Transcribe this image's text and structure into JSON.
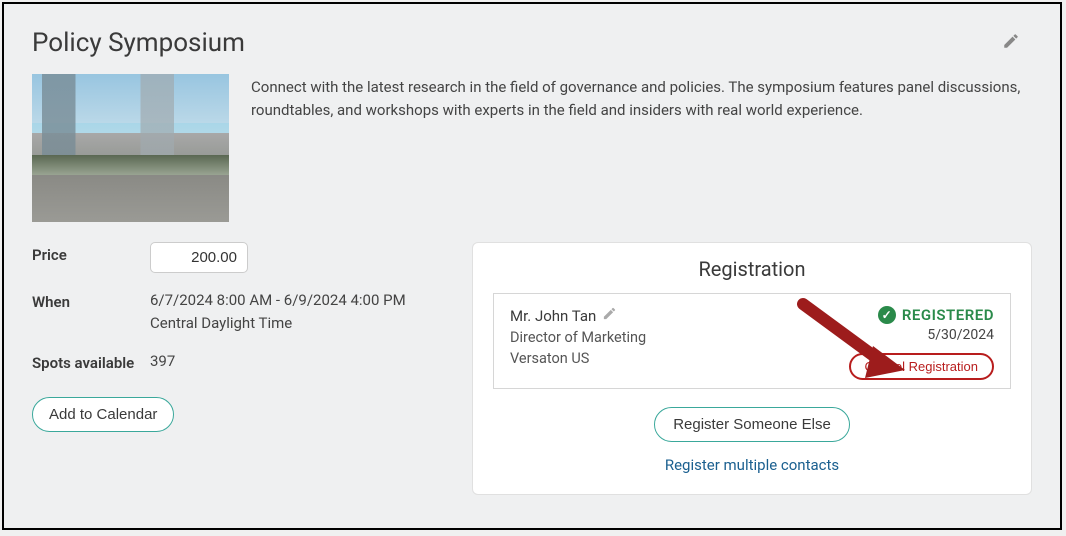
{
  "event": {
    "title": "Policy Symposium",
    "description": "Connect with the latest research in the field of governance and policies. The symposium features panel discussions, roundtables, and workshops with experts in the field and insiders with real world experience."
  },
  "details": {
    "price_label": "Price",
    "price_value": "200.00",
    "when_label": "When",
    "when_value_line1": "6/7/2024 8:00 AM - 6/9/2024 4:00 PM",
    "when_value_line2": "Central Daylight Time",
    "spots_label": "Spots available",
    "spots_value": "397",
    "add_to_calendar_label": "Add to Calendar"
  },
  "registration": {
    "title": "Registration",
    "registrant_name": "Mr. John Tan",
    "registrant_title": "Director of Marketing",
    "registrant_org": "Versaton US",
    "status_label": "REGISTERED",
    "registered_date": "5/30/2024",
    "cancel_label": "Cancel Registration",
    "register_someone_else_label": "Register Someone Else",
    "register_multiple_label": "Register multiple contacts"
  }
}
